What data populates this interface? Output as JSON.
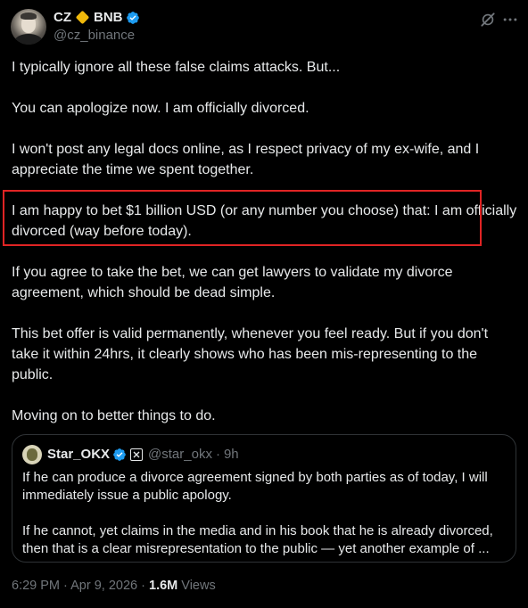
{
  "author": {
    "name": "CZ",
    "name_suffix": "BNB",
    "handle": "@cz_binance",
    "verified": true,
    "avatar": "profile-photo",
    "diamond_color": "#f0b90b"
  },
  "header_icons": {
    "grok": "grok-icon",
    "more": "more-icon"
  },
  "post": {
    "paragraphs": [
      "I typically ignore all these false claims attacks. But...",
      "You can apologize now. I am officially divorced.",
      "I won't post any legal docs online, as I respect privacy of my ex-wife, and I appreciate the time we spent together.",
      "I am happy to bet $1 billion USD (or any number you choose) that: I am officially divorced (way before today).",
      "If you agree to take the bet, we can get lawyers to validate my divorce agreement, which should be dead simple.",
      "This bet offer is valid permanently, whenever you feel ready. But if you don't take it within 24hrs, it clearly shows who has been mis-representing to the public.",
      "Moving on to better things to do."
    ],
    "highlight_color": "#e02424"
  },
  "quote": {
    "name": "Star_OKX",
    "handle": "@star_okx",
    "separator": "·",
    "time": "9h",
    "verified": true,
    "paragraphs": [
      "If he can produce a divorce agreement signed by both parties as of today, I will immediately issue a public apology.",
      "If he cannot, yet claims in the media and in his book that he is already divorced, then that is a clear misrepresentation to the public — yet another example of ..."
    ]
  },
  "meta": {
    "time": "6:29 PM",
    "separator": "·",
    "date": "Apr 9, 2026",
    "views_count": "1.6M",
    "views_label": "Views"
  },
  "colors": {
    "background": "#000000",
    "text": "#e7e9ea",
    "secondary": "#71767b",
    "verified": "#1d9bf0",
    "border": "#2f3336"
  }
}
